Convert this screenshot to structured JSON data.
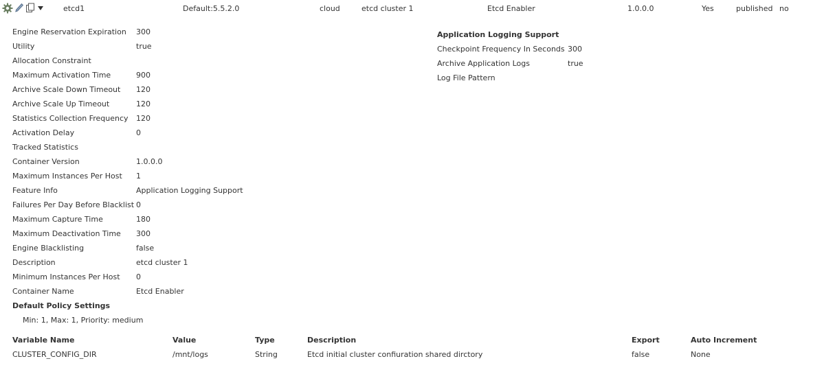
{
  "row": {
    "name": "etcd1",
    "distribution": "Default:5.5.2.0",
    "type": "cloud",
    "description": "etcd cluster 1",
    "enabler": "Etcd Enabler",
    "version": "1.0.0.0",
    "flag": "Yes",
    "status": "published",
    "extra": "no",
    "icons": [
      "gear-icon",
      "pencil-icon",
      "copy-icon",
      "dropdown-caret-icon"
    ]
  },
  "properties": [
    {
      "label": "Engine Reservation Expiration",
      "value": "300"
    },
    {
      "label": "Utility",
      "value": "true"
    },
    {
      "label": "Allocation Constraint",
      "value": ""
    },
    {
      "label": "Maximum Activation Time",
      "value": "900"
    },
    {
      "label": "Archive Scale Down Timeout",
      "value": "120"
    },
    {
      "label": "Archive Scale Up Timeout",
      "value": "120"
    },
    {
      "label": "Statistics Collection Frequency",
      "value": "120"
    },
    {
      "label": "Activation Delay",
      "value": "0"
    },
    {
      "label": "Tracked Statistics",
      "value": ""
    },
    {
      "label": "Container Version",
      "value": "1.0.0.0"
    },
    {
      "label": "Maximum Instances Per Host",
      "value": "1"
    },
    {
      "label": "Feature Info",
      "value": "Application Logging Support"
    },
    {
      "label": "Failures Per Day Before Blacklist",
      "value": "0"
    },
    {
      "label": "Maximum Capture Time",
      "value": "180"
    },
    {
      "label": "Maximum Deactivation Time",
      "value": "300"
    },
    {
      "label": "Engine Blacklisting",
      "value": "false"
    },
    {
      "label": "Description",
      "value": "etcd cluster 1"
    },
    {
      "label": "Minimum Instances Per Host",
      "value": "0"
    },
    {
      "label": "Container Name",
      "value": "Etcd Enabler"
    }
  ],
  "policy": {
    "heading": "Default Policy Settings",
    "text": "Min: 1, Max: 1, Priority: medium"
  },
  "logging": {
    "heading": "Application Logging Support",
    "items": [
      {
        "label": "Checkpoint Frequency In Seconds",
        "value": "300"
      },
      {
        "label": "Archive Application Logs",
        "value": "true"
      },
      {
        "label": "Log File Pattern",
        "value": ""
      }
    ]
  },
  "variables": {
    "headers": [
      "Variable Name",
      "Value",
      "Type",
      "Description",
      "Export",
      "Auto Increment"
    ],
    "rows": [
      [
        "CLUSTER_CONFIG_DIR",
        "/mnt/logs",
        "String",
        "Etcd initial cluster confiuration shared dirctory",
        "false",
        "None"
      ]
    ]
  }
}
